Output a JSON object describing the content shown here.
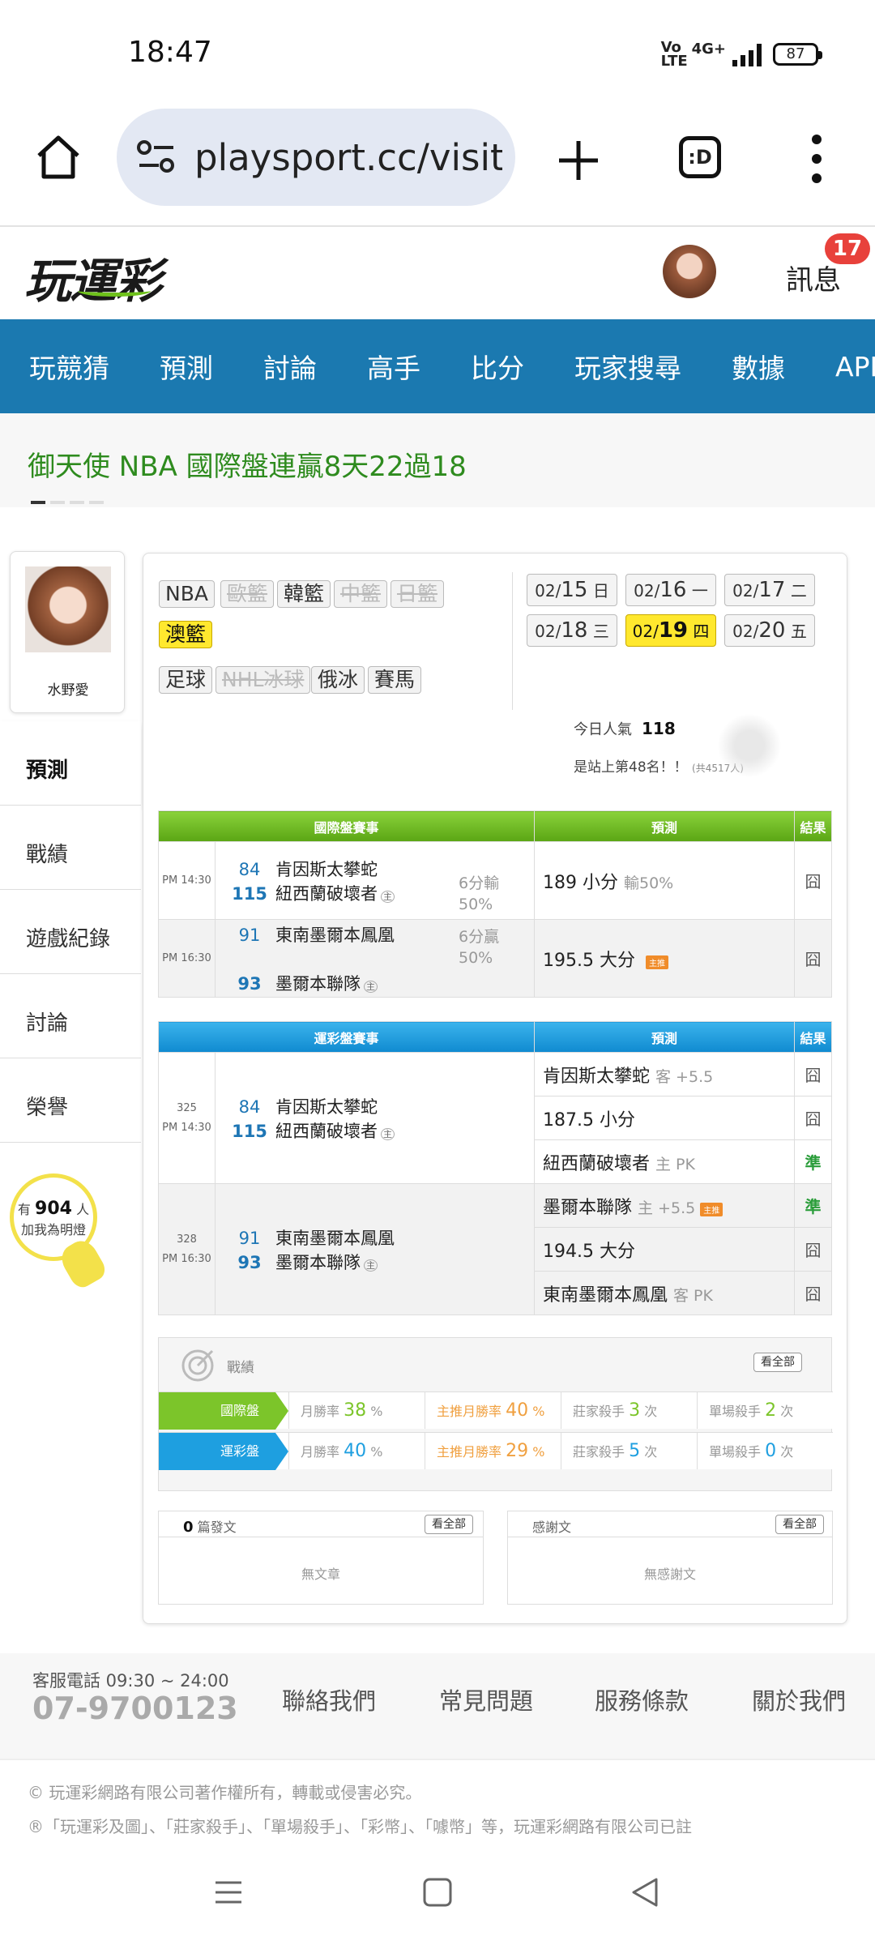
{
  "status": {
    "time": "18:47",
    "battery": "87",
    "volte": "Vo LTE",
    "network": "4G+"
  },
  "browser": {
    "url": "playsport.cc/visit",
    "tab_label": ":D"
  },
  "site": {
    "logo": "玩運彩",
    "messages_label": "訊息",
    "messages_count": "17"
  },
  "nav": [
    "玩競猜",
    "預測",
    "討論",
    "高手",
    "比分",
    "玩家搜尋",
    "數據",
    "APP"
  ],
  "ticker": {
    "text": "御天使 NBA 國際盤連贏8天22過18"
  },
  "profile": {
    "name": "水野愛"
  },
  "sidemenu": [
    "預測",
    "戰績",
    "遊戲紀錄",
    "討論",
    "榮譽"
  ],
  "fans": {
    "prefix": "有",
    "count": "904",
    "suffix": "人",
    "cta": "加我為明燈"
  },
  "leagues": {
    "row1": [
      {
        "label": "NBA",
        "state": "normal"
      },
      {
        "label": "歐籃",
        "state": "disabled"
      },
      {
        "label": "韓籃",
        "state": "normal"
      },
      {
        "label": "中籃",
        "state": "disabled"
      },
      {
        "label": "日籃",
        "state": "disabled"
      }
    ],
    "row2": [
      {
        "label": "澳籃",
        "state": "selected"
      }
    ],
    "row3": [
      {
        "label": "足球",
        "state": "normal"
      },
      {
        "label": "NHL冰球",
        "state": "disabled"
      },
      {
        "label": "俄冰",
        "state": "normal"
      },
      {
        "label": "賽馬",
        "state": "normal"
      }
    ]
  },
  "dates": [
    {
      "md": "02/",
      "d": "15",
      "w": "日",
      "selected": false
    },
    {
      "md": "02/",
      "d": "16",
      "w": "一",
      "selected": false
    },
    {
      "md": "02/",
      "d": "17",
      "w": "二",
      "selected": false
    },
    {
      "md": "02/",
      "d": "18",
      "w": "三",
      "selected": false
    },
    {
      "md": "02/",
      "d": "19",
      "w": "四",
      "selected": true
    },
    {
      "md": "02/",
      "d": "20",
      "w": "五",
      "selected": false
    }
  ],
  "popularity": {
    "label": "今日人氣",
    "value": "118",
    "rank_text": "是站上第48名！！",
    "rank_total": "(共4517人)"
  },
  "intl_table": {
    "headers": [
      "國際盤賽事",
      "預測",
      "結果"
    ],
    "rows": [
      {
        "time": "PM 14:30",
        "away_score": "84",
        "away": "肯因斯太攀蛇",
        "home_score": "115",
        "home": "紐西蘭破壞者",
        "home_mark": "主",
        "line": "6分輸",
        "pct": "50%",
        "pred": "189 小分",
        "pred_note": "輸50%",
        "result": "囧"
      },
      {
        "time": "PM 16:30",
        "away_score": "91",
        "away": "東南墨爾本鳳凰",
        "home_score": "93",
        "home": "墨爾本聯隊",
        "home_mark": "主",
        "line": "6分贏",
        "pct": "50%",
        "pred": "195.5 大分",
        "pred_note": "主推",
        "result": "囧"
      }
    ]
  },
  "lottery_table": {
    "headers": [
      "運彩盤賽事",
      "預測",
      "結果"
    ],
    "games": [
      {
        "no": "325",
        "time": "PM 14:30",
        "away_score": "84",
        "away": "肯因斯太攀蛇",
        "home_score": "115",
        "home": "紐西蘭破壞者",
        "home_mark": "主",
        "preds": [
          {
            "text": "肯因斯太攀蛇",
            "note": "客 +5.5",
            "tag": "",
            "result": "囧",
            "hit": false
          },
          {
            "text": "187.5 小分",
            "note": "",
            "tag": "",
            "result": "囧",
            "hit": false
          },
          {
            "text": "紐西蘭破壞者",
            "note": "主 PK",
            "tag": "",
            "result": "準",
            "hit": true
          }
        ]
      },
      {
        "no": "328",
        "time": "PM 16:30",
        "away_score": "91",
        "away": "東南墨爾本鳳凰",
        "home_score": "93",
        "home": "墨爾本聯隊",
        "home_mark": "主",
        "preds": [
          {
            "text": "墨爾本聯隊",
            "note": "主 +5.5",
            "tag": "主推",
            "result": "準",
            "hit": true
          },
          {
            "text": "194.5 大分",
            "note": "",
            "tag": "",
            "result": "囧",
            "hit": false
          },
          {
            "text": "東南墨爾本鳳凰",
            "note": "客 PK",
            "tag": "",
            "result": "囧",
            "hit": false
          }
        ]
      }
    ]
  },
  "stats": {
    "title": "戰績",
    "view_all": "看全部",
    "rows": [
      {
        "label": "國際盤",
        "color": "#7cc52a",
        "cells": [
          {
            "k": "月勝率",
            "v": "38",
            "u": "%",
            "c": "#7cc52a"
          },
          {
            "k": "主推月勝率",
            "v": "40",
            "u": "%",
            "c": "#f0a040"
          },
          {
            "k": "莊家殺手",
            "v": "3",
            "u": "次",
            "c": "#7cc52a"
          },
          {
            "k": "單場殺手",
            "v": "2",
            "u": "次",
            "c": "#7cc52a"
          }
        ]
      },
      {
        "label": "運彩盤",
        "color": "#1e9fe0",
        "cells": [
          {
            "k": "月勝率",
            "v": "40",
            "u": "%",
            "c": "#1e9fe0"
          },
          {
            "k": "主推月勝率",
            "v": "29",
            "u": "%",
            "c": "#f0a040"
          },
          {
            "k": "莊家殺手",
            "v": "5",
            "u": "次",
            "c": "#1e9fe0"
          },
          {
            "k": "單場殺手",
            "v": "0",
            "u": "次",
            "c": "#1e9fe0"
          }
        ]
      }
    ]
  },
  "posts": {
    "count": "0",
    "label": "篇發文",
    "view_all": "看全部",
    "empty": "無文章"
  },
  "thanks": {
    "label": "感謝文",
    "view_all": "看全部",
    "empty": "無感謝文"
  },
  "footer": {
    "service_hours": "客服電話 09:30 ~ 24:00",
    "phone": "07-9700123",
    "links": [
      "聯絡我們",
      "常見問題",
      "服務條款",
      "關於我們"
    ],
    "copyright": "© 玩運彩網路有限公司著作權所有，轉載或侵害必究。",
    "trademark": "®「玩運彩及圖」、「莊家殺手」、「單場殺手」、「彩幣」、「噱幣」等，玩運彩網路有限公司已註"
  }
}
